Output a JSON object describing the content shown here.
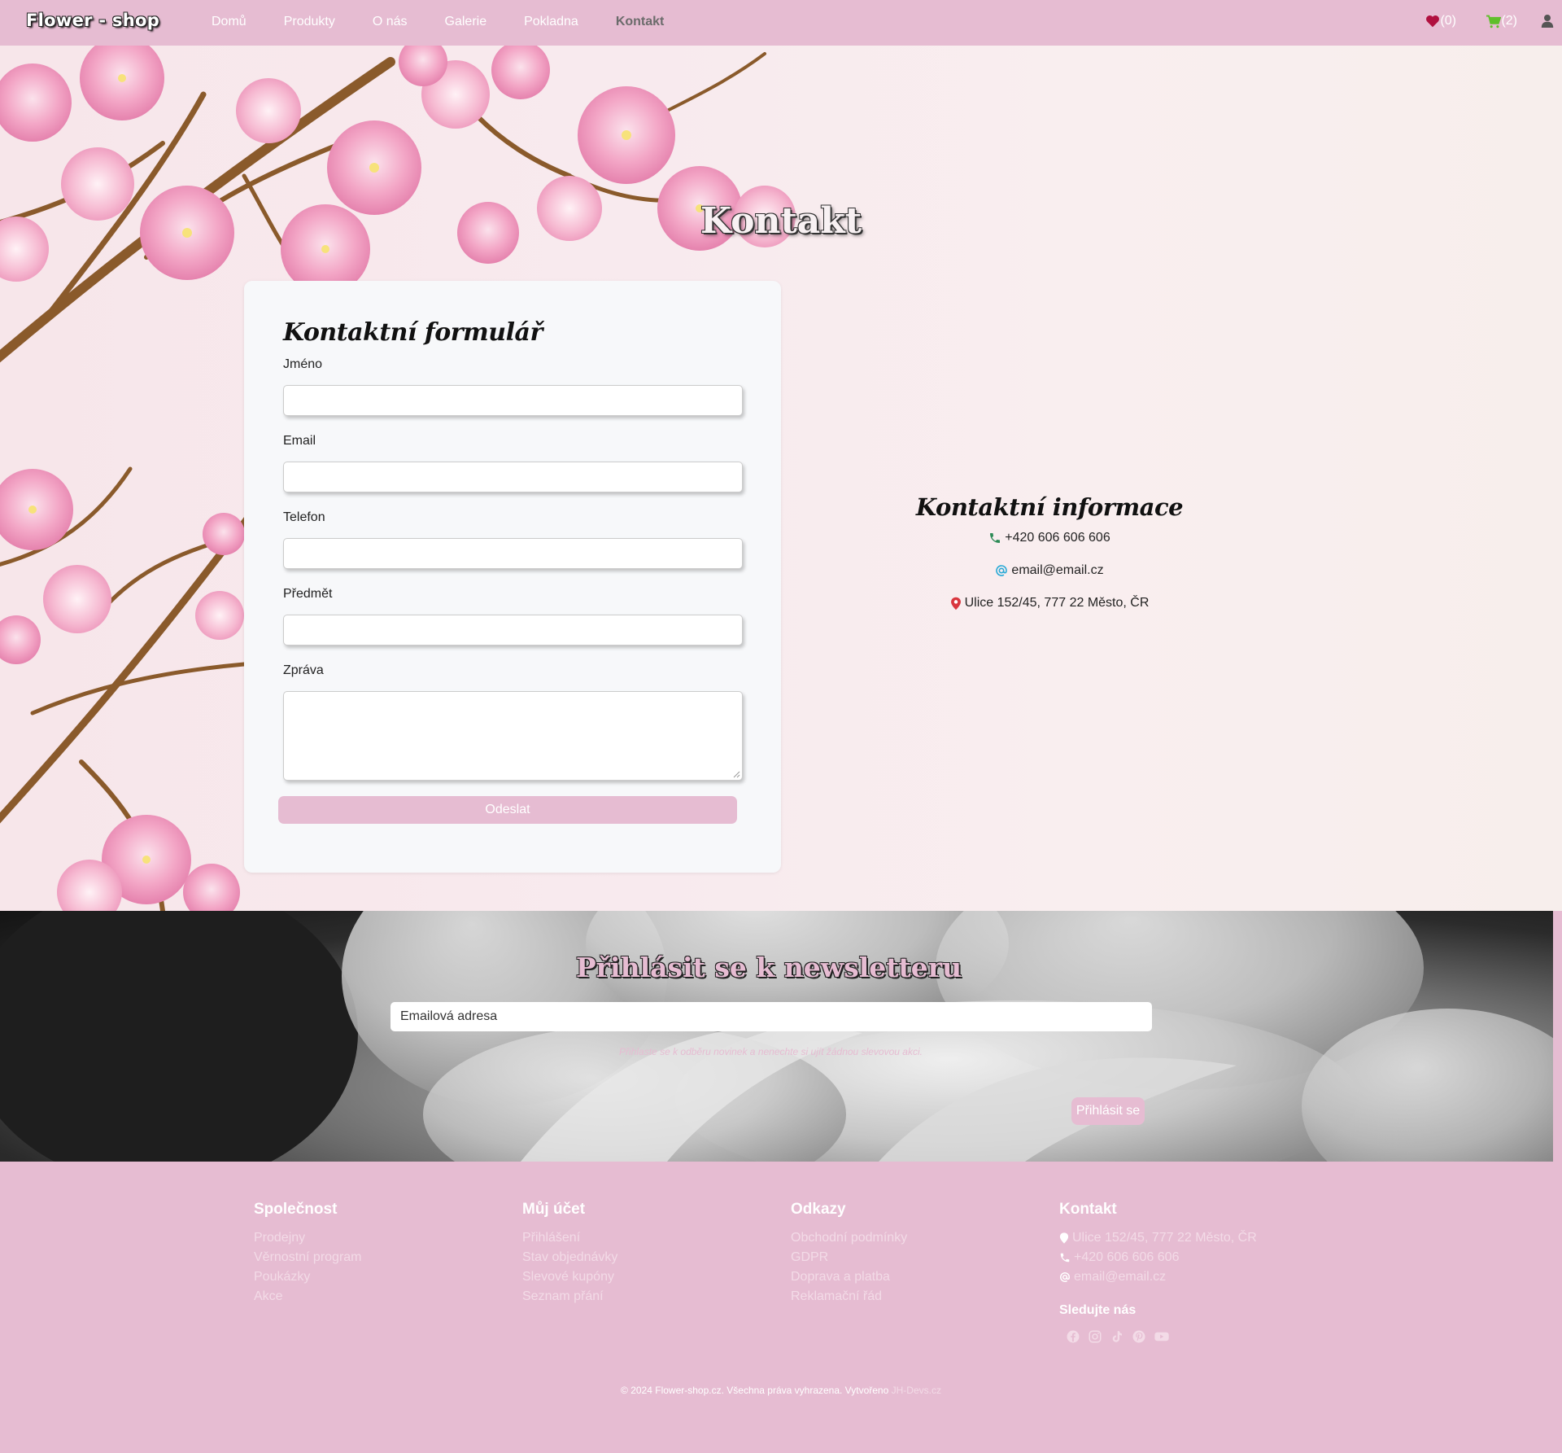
{
  "brand": "Flower - shop",
  "nav": {
    "links": [
      "Domů",
      "Produkty",
      "O nás",
      "Galerie",
      "Pokladna",
      "Kontakt"
    ],
    "active_index": 5,
    "wishlist_count": "(0)",
    "cart_count": "(2)"
  },
  "hero": {
    "title": "Kontakt"
  },
  "form": {
    "heading": "Kontaktní formulář",
    "fields": [
      "Jméno",
      "Email",
      "Telefon",
      "Předmět",
      "Zpráva"
    ],
    "submit": "Odeslat"
  },
  "contact_info": {
    "heading": "Kontaktní informace",
    "phone": "+420 606 606 606",
    "email": "email@email.cz",
    "address": "Ulice 152/45, 777 22 Město, ČR"
  },
  "newsletter": {
    "title": "Přihlásit se k newsletteru",
    "placeholder": "Emailová adresa",
    "note": "Přihlaste se k odběru novinek a nenechte si ujít žádnou slevovou akci.",
    "button": "Přihlásit se"
  },
  "footer": {
    "company": {
      "heading": "Společnost",
      "links": [
        "Prodejny",
        "Věrnostní program",
        "Poukázky",
        "Akce"
      ]
    },
    "account": {
      "heading": "Můj účet",
      "links": [
        "Přihlášení",
        "Stav objednávky",
        "Slevové kupóny",
        "Seznam přání"
      ]
    },
    "links": {
      "heading": "Odkazy",
      "links": [
        "Obchodní podmínky",
        "GDPR",
        "Doprava a platba",
        "Reklamační řád"
      ]
    },
    "contact": {
      "heading": "Kontakt",
      "address": "Ulice 152/45, 777 22 Město, ČR",
      "phone": "+420 606 606 606",
      "email": "email@email.cz",
      "follow": "Sledujte nás",
      "social": [
        "facebook-icon",
        "instagram-icon",
        "tiktok-icon",
        "pinterest-icon",
        "youtube-icon"
      ]
    },
    "copyright": "© 2024 Flower-shop.cz. Všechna práva vyhrazena. Vytvořeno",
    "credit": "JH-Devs.cz"
  },
  "colors": {
    "accent": "#e6bcd2",
    "phone_icon": "#2e8b57",
    "email_icon": "#29a9d6",
    "address_icon": "#d9363e",
    "heart": "#b0103f",
    "cart": "#5fbf2a"
  }
}
